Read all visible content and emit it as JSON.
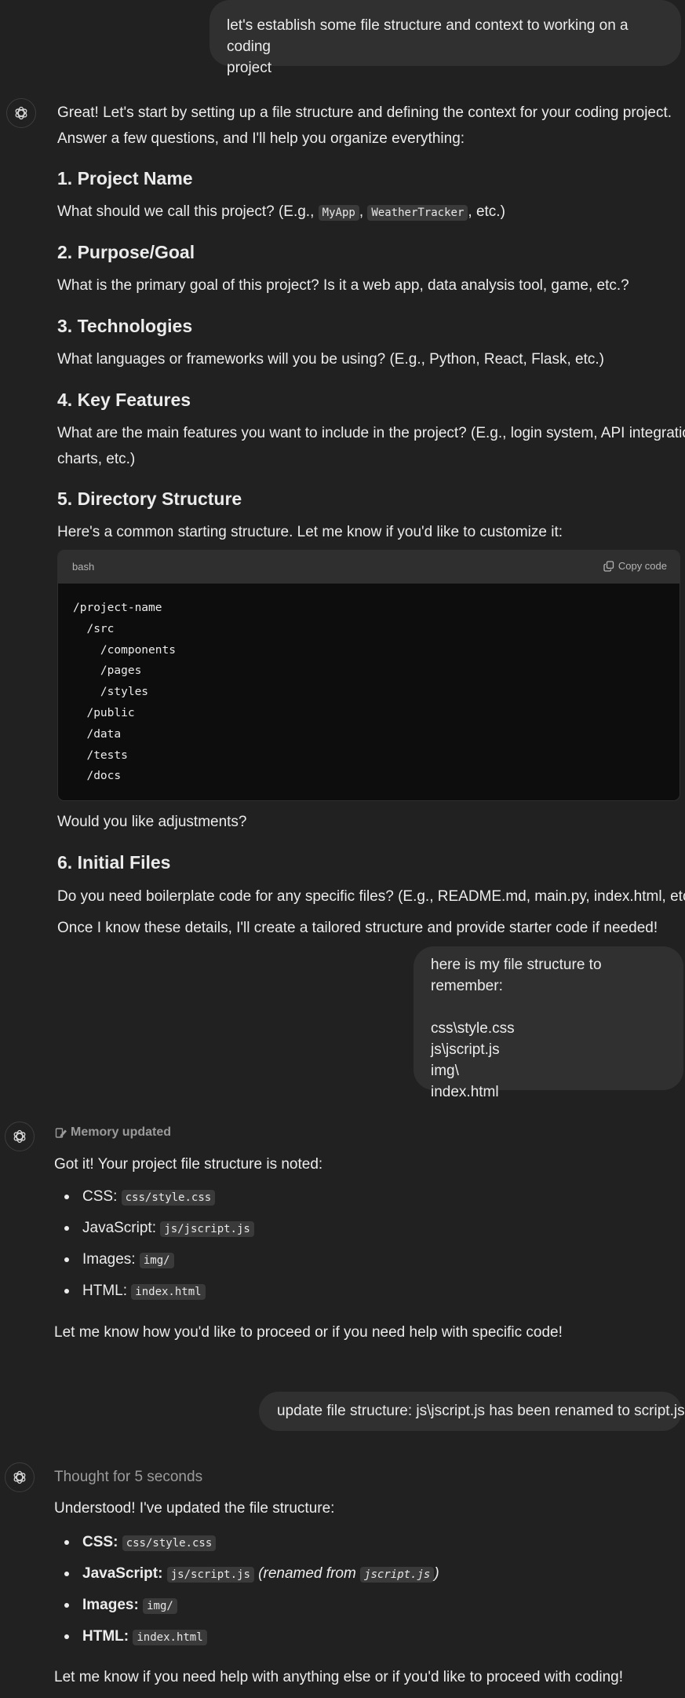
{
  "conversation": {
    "msg1_user": {
      "line1": "let's establish some file structure and context to working on a coding",
      "line2": "project"
    },
    "msg2_assistant": {
      "intro_line1": "Great! Let's start by setting up a file structure and defining the context for your coding project.",
      "intro_line2": "Answer a few questions, and I'll help you organize everything:",
      "s1_heading": "1. Project Name",
      "s1_text_prefix": "What should we call this project? (E.g., ",
      "s1_code1": "MyApp",
      "s1_sep": ", ",
      "s1_code2": "WeatherTracker",
      "s1_text_suffix": ", etc.)",
      "s2_heading": "2. Purpose/Goal",
      "s2_text": "What is the primary goal of this project? Is it a web app, data analysis tool, game, etc.?",
      "s3_heading": "3. Technologies",
      "s3_text": "What languages or frameworks will you be using? (E.g., Python, React, Flask, etc.)",
      "s4_heading": "4. Key Features",
      "s4_text_line1": "What are the main features you want to include in the project? (E.g., login system, API integration,",
      "s4_text_line2": "charts, etc.)",
      "s5_heading": "5. Directory Structure",
      "s5_text": "Here's a common starting structure. Let me know if you'd like to customize it:",
      "code_lang": "bash",
      "copy_label": "Copy code",
      "code_content": "/project-name\n  /src\n    /components\n    /pages\n    /styles\n  /public\n  /data\n  /tests\n  /docs",
      "after_code": "Would you like adjustments?",
      "s6_heading": "6. Initial Files",
      "s6_text": "Do you need boilerplate code for any specific files? (E.g., README.md, main.py, index.html, etc.)",
      "closing": "Once I know these details, I'll create a tailored structure and provide starter code if needed!"
    },
    "msg3_user": {
      "line1": "here is my file structure to remember:",
      "line2": "css\\style.css",
      "line3": "js\\jscript.js",
      "line4": "img\\",
      "line5": "index.html"
    },
    "msg4_assistant": {
      "memory_label": "Memory updated",
      "intro": "Got it! Your project file structure is noted:",
      "items": [
        {
          "label": "CSS: ",
          "code": "css/style.css"
        },
        {
          "label": "JavaScript: ",
          "code": "js/jscript.js"
        },
        {
          "label": "Images: ",
          "code": "img/"
        },
        {
          "label": "HTML: ",
          "code": "index.html"
        }
      ],
      "closing": "Let me know how you'd like to proceed or if you need help with specific code!"
    },
    "msg5_user": {
      "text": "update file structure:  js\\jscript.js has been renamed to script.js"
    },
    "msg6_assistant": {
      "thought_label": "Thought for 5 seconds",
      "intro": "Understood! I've updated the file structure:",
      "items": [
        {
          "label": "CSS:",
          "code": "css/style.css"
        },
        {
          "label": "JavaScript:",
          "code": "js/script.js",
          "note_prefix": "(renamed from ",
          "note_code": "jscript.js",
          "note_suffix": ")"
        },
        {
          "label": "Images:",
          "code": "img/"
        },
        {
          "label": "HTML:",
          "code": "index.html"
        }
      ],
      "closing": "Let me know if you need help with anything else or if you'd like to proceed with coding!"
    }
  }
}
